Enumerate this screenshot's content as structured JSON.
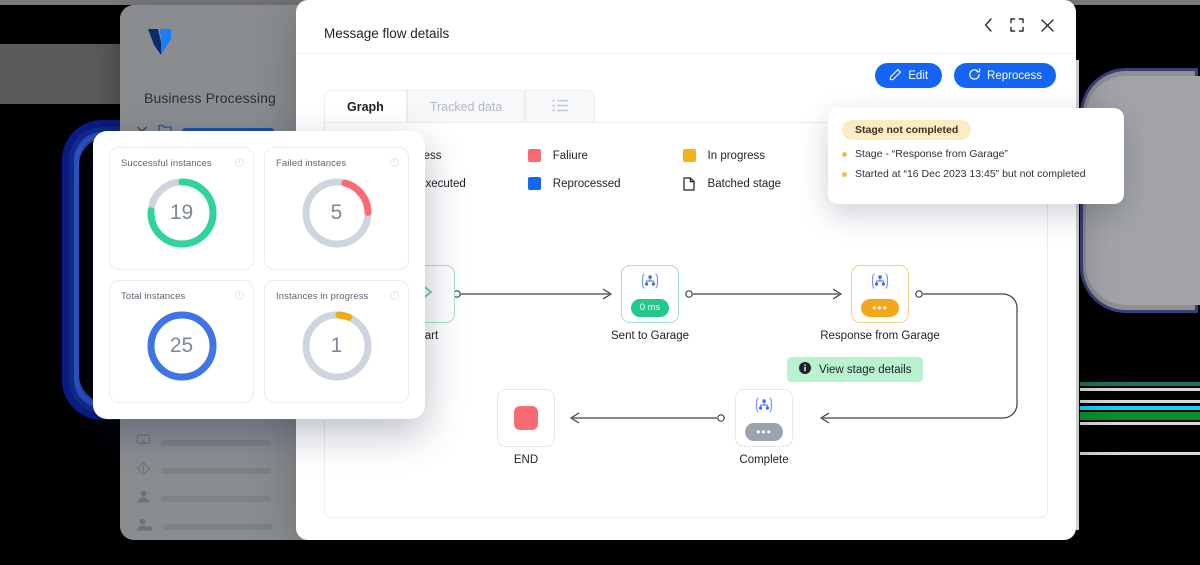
{
  "app": {
    "logo": "logo-mark",
    "name": "Business Processing",
    "sidebar_items": [
      {
        "icon": "chevron-down-icon",
        "icon2": "folder-icon"
      },
      {
        "icon": "monitor-icon"
      },
      {
        "icon": "diamond-icon"
      },
      {
        "icon": "user-icon"
      },
      {
        "icon": "user-settings-icon"
      }
    ]
  },
  "stats": {
    "cards": [
      {
        "title": "Successful instances",
        "value": "19",
        "color": "#2fd49a",
        "pct": 76,
        "info": "info-icon"
      },
      {
        "title": "Failed instances",
        "value": "5",
        "color": "#fa6a72",
        "pct": 20,
        "info": "info-icon"
      },
      {
        "title": "Total instances",
        "value": "25",
        "color": "#3d74e8",
        "pct": 100,
        "info": "info-icon"
      },
      {
        "title": "Instances in progress",
        "value": "1",
        "color": "#f2a818",
        "pct": 5,
        "info": "info-icon"
      }
    ],
    "track_color": "#cfd5de"
  },
  "modal": {
    "title": "Message flow details",
    "controls": [
      {
        "name": "back-icon",
        "glyph": "‹"
      },
      {
        "name": "expand-icon",
        "glyph": "⛶"
      },
      {
        "name": "close-icon",
        "glyph": "✕"
      }
    ],
    "buttons": [
      {
        "label": "Edit",
        "icon": "edit-icon"
      },
      {
        "label": "Reprocess",
        "icon": "refresh-icon"
      }
    ],
    "tabs": [
      {
        "label": "Graph",
        "active": true
      },
      {
        "label": "Tracked data",
        "active": false
      },
      {
        "label": "",
        "icon": "list-icon",
        "active": false
      }
    ]
  },
  "legend": {
    "items": [
      {
        "label": "Success",
        "color": "#2fd49a",
        "shape": "square"
      },
      {
        "label": "Faliure",
        "color": "#fa6a72",
        "shape": "square"
      },
      {
        "label": "In progress",
        "color": "#f2b418",
        "shape": "square"
      },
      {
        "label": "Not executed",
        "color": "#9aa2ad",
        "shape": "square"
      },
      {
        "label": "Reprocessed",
        "color": "#1464f6",
        "shape": "square"
      },
      {
        "label": "Batched stage",
        "color": "#1d2026",
        "shape": "page-icon"
      }
    ]
  },
  "graph": {
    "nodes": [
      {
        "id": "start",
        "label": "Start",
        "icon": "play-chevron-icon",
        "state": "green",
        "badge": null
      },
      {
        "id": "sent",
        "label": "Sent to Garage",
        "icon": "sitemap-icon",
        "state": "green",
        "badge": "0 ms",
        "badge_style": "g"
      },
      {
        "id": "response",
        "label": "Response from Garage",
        "icon": "sitemap-icon",
        "state": "amber",
        "badge": "•••",
        "badge_style": "a"
      },
      {
        "id": "complete",
        "label": "Complete",
        "icon": "sitemap-icon",
        "state": "plain",
        "badge": "•••",
        "badge_style": "gray"
      },
      {
        "id": "end",
        "label": "END",
        "icon": "stop-square-icon",
        "state": "plain",
        "badge": null
      }
    ],
    "tooltip": {
      "label": "View stage details",
      "icon": "info-filled-icon"
    }
  },
  "popover": {
    "status": "Stage not completed",
    "lines": [
      "Stage - “Response from Garage”",
      "Started at “16 Dec 2023 13:45” but not completed"
    ]
  }
}
